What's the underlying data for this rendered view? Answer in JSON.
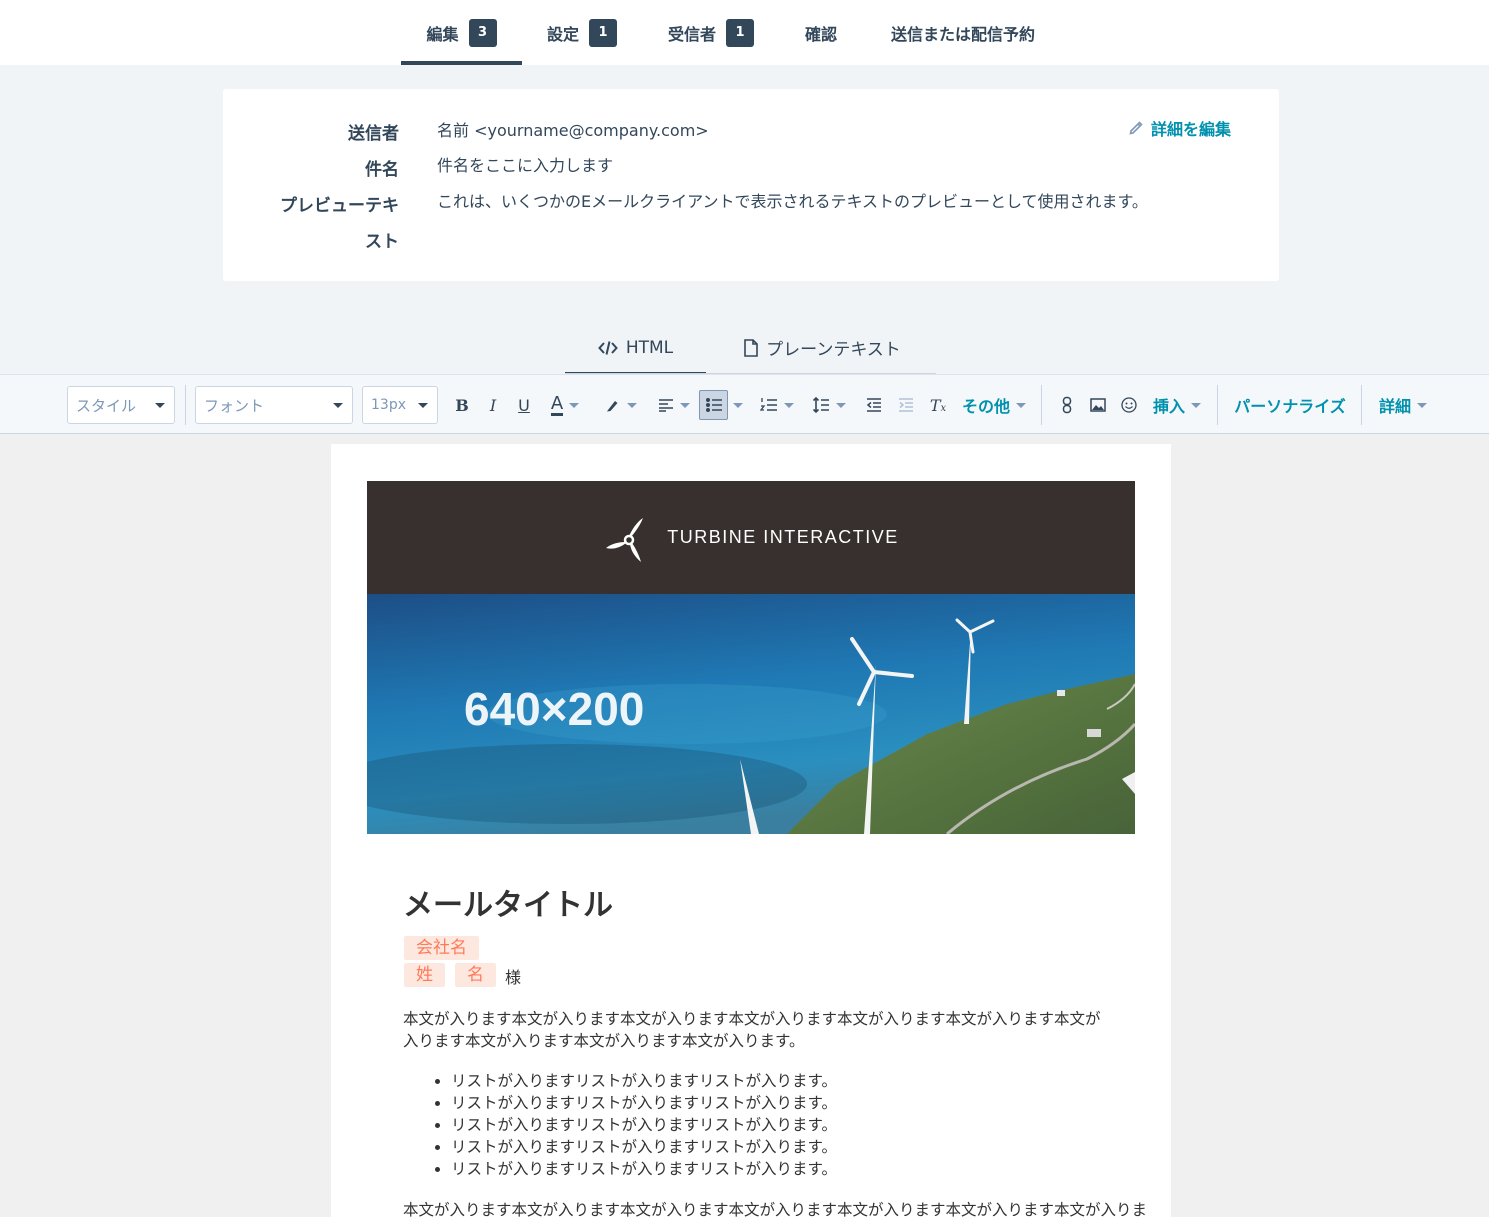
{
  "steps": [
    {
      "label": "編集",
      "badge": "3"
    },
    {
      "label": "設定",
      "badge": "1"
    },
    {
      "label": "受信者",
      "badge": "1"
    },
    {
      "label": "確認",
      "badge": ""
    },
    {
      "label": "送信または配信予約",
      "badge": ""
    }
  ],
  "details": {
    "from_label": "送信者",
    "from_value": "名前 <yourname@company.com>",
    "subject_label": "件名",
    "subject_value": "件名をここに入力します",
    "preview_label_line1": "プレビューテキ",
    "preview_label_line2": "スト",
    "preview_value": "これは、いくつかのEメールクライアントで表示されるテキストのプレビューとして使用されます。",
    "edit_link": "詳細を編集"
  },
  "view_tabs": {
    "html": "HTML",
    "plaintext": "プレーンテキスト"
  },
  "toolbar": {
    "style": "スタイル",
    "font": "フォント",
    "size": "13px",
    "more": "その他",
    "insert": "挿入",
    "personalize": "パーソナライズ",
    "details": "詳細",
    "icons": [
      "bold-icon",
      "italic-icon",
      "underline-icon",
      "text-color-icon",
      "highlight-icon",
      "align-icon",
      "bulleted-list-icon",
      "numbered-list-icon",
      "line-height-icon",
      "outdent-icon",
      "indent-icon",
      "clear-format-icon",
      "link-icon",
      "image-icon",
      "emoji-icon"
    ]
  },
  "email": {
    "brand": "TURBINE INTERACTIVE",
    "hero_label": "640×200",
    "title": "メールタイトル",
    "company_token": "会社名",
    "last_name_token": "姓",
    "first_name_token": "名",
    "honorific": "様",
    "paragraph1": "本文が入ります本文が入ります本文が入ります本文が入ります本文が入ります本文が入ります本文が入ります本文が入ります本文が入ります本文が入ります。",
    "list_items": [
      "リストが入りますリストが入りますリストが入ります。",
      "リストが入りますリストが入りますリストが入ります。",
      "リストが入りますリストが入りますリストが入ります。",
      "リストが入りますリストが入りますリストが入ります。",
      "リストが入りますリストが入りますリストが入ります。"
    ],
    "paragraph2": "本文が入ります本文が入ります本文が入ります本文が入ります本文が入ります本文が入ります本文が入りま"
  },
  "colors": {
    "primary_text": "#33475b",
    "link": "#0091ae",
    "token_bg": "#fde8e0",
    "token_text": "#ff7a59",
    "header_bg": "#38302e"
  }
}
